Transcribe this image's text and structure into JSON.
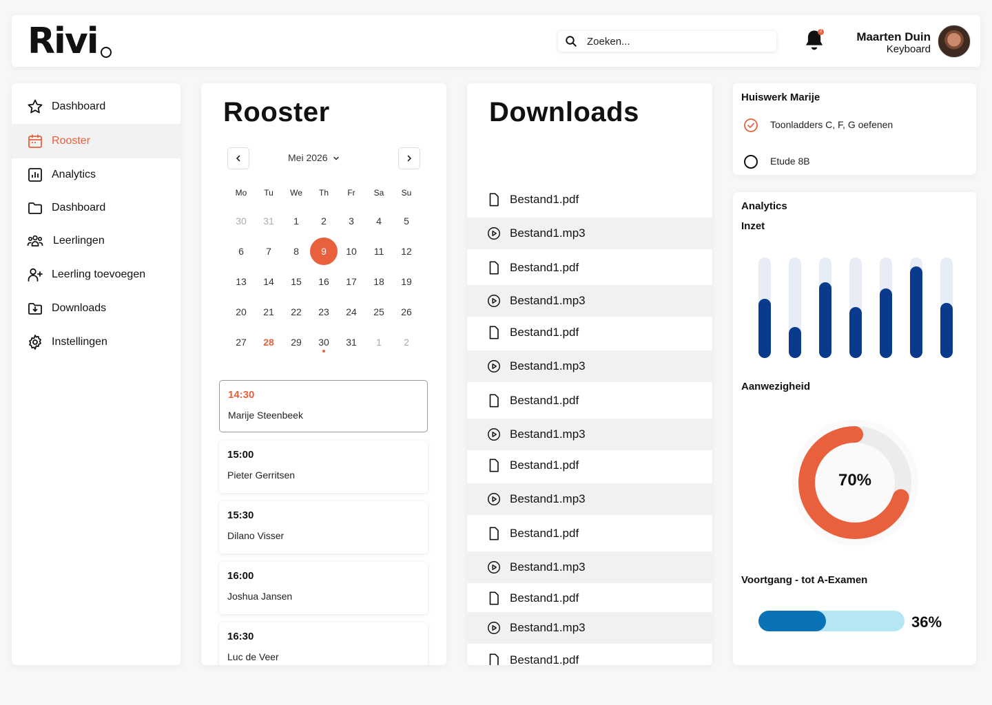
{
  "header": {
    "logo": "Rivi",
    "search_placeholder": "Zoeken...",
    "notification_count": "2",
    "user_name": "Maarten Duin",
    "user_role": "Keyboard"
  },
  "sidebar": {
    "items": [
      {
        "label": "Dashboard",
        "icon": "star-icon"
      },
      {
        "label": "Rooster",
        "icon": "calendar-icon",
        "active": true
      },
      {
        "label": "Analytics",
        "icon": "bar-chart-icon"
      },
      {
        "label": "Dashboard",
        "icon": "folder-icon"
      },
      {
        "label": "Leerlingen",
        "icon": "users-icon"
      },
      {
        "label": "Leerling toevoegen",
        "icon": "user-add-icon"
      },
      {
        "label": "Downloads",
        "icon": "download-icon"
      },
      {
        "label": "Instellingen",
        "icon": "gear-icon"
      }
    ]
  },
  "rooster": {
    "title": "Rooster",
    "month": "Mei 2026",
    "weekdays": [
      "Mo",
      "Tu",
      "We",
      "Th",
      "Fr",
      "Sa",
      "Su"
    ],
    "weeks": [
      [
        "30",
        "31",
        "1",
        "2",
        "3",
        "4",
        "5"
      ],
      [
        "6",
        "7",
        "8",
        "9",
        "10",
        "11",
        "12"
      ],
      [
        "13",
        "14",
        "15",
        "16",
        "17",
        "18",
        "19"
      ],
      [
        "20",
        "21",
        "22",
        "23",
        "24",
        "25",
        "26"
      ],
      [
        "27",
        "28",
        "29",
        "30",
        "31",
        "1",
        "2"
      ]
    ],
    "appointments": [
      {
        "time": "14:30",
        "name": "Marije Steenbeek"
      },
      {
        "time": "15:00",
        "name": "Pieter Gerritsen"
      },
      {
        "time": "15:30",
        "name": "Dilano Visser"
      },
      {
        "time": "16:00",
        "name": "Joshua Jansen"
      },
      {
        "time": "16:30",
        "name": "Luc de Veer"
      }
    ]
  },
  "downloads": {
    "title": "Downloads",
    "files": [
      {
        "name": "Bestand1.pdf",
        "type": "pdf"
      },
      {
        "name": "Bestand1.mp3",
        "type": "mp3"
      },
      {
        "name": "Bestand1.pdf",
        "type": "pdf"
      },
      {
        "name": "Bestand1.mp3",
        "type": "mp3"
      },
      {
        "name": "Bestand1.pdf",
        "type": "pdf"
      },
      {
        "name": "Bestand1.mp3",
        "type": "mp3"
      },
      {
        "name": "Bestand1.pdf",
        "type": "pdf"
      },
      {
        "name": "Bestand1.mp3",
        "type": "mp3"
      },
      {
        "name": "Bestand1.pdf",
        "type": "pdf"
      },
      {
        "name": "Bestand1.mp3",
        "type": "mp3"
      },
      {
        "name": "Bestand1.pdf",
        "type": "pdf"
      },
      {
        "name": "Bestand1.mp3",
        "type": "mp3"
      },
      {
        "name": "Bestand1.pdf",
        "type": "pdf"
      },
      {
        "name": "Bestand1.mp3",
        "type": "mp3"
      },
      {
        "name": "Bestand1.pdf",
        "type": "pdf"
      }
    ]
  },
  "huiswerk": {
    "title": "Huiswerk Marije",
    "tasks": [
      {
        "label": "Toonladders C, F, G oefenen",
        "done": true
      },
      {
        "label": "Etude 8B",
        "done": false
      }
    ]
  },
  "analytics": {
    "title": "Analytics",
    "inzet_label": "Inzet",
    "inzet_values": [
      0.59,
      0.31,
      0.75,
      0.51,
      0.69,
      0.91,
      0.55
    ],
    "aanwezigheid_label": "Aanwezigheid",
    "aanwezigheid_value": "70%",
    "aanwezigheid_fraction": 0.7,
    "voortgang_label": "Voortgang - tot A-Examen",
    "voortgang_value": "36%",
    "voortgang_fraction": 0.46
  },
  "colors": {
    "accent": "#e8603c",
    "bar": "#0a3a8c",
    "bar_track": "#e8ecf6",
    "progress": "#0a73b8",
    "progress_track": "#b5e6f4"
  }
}
